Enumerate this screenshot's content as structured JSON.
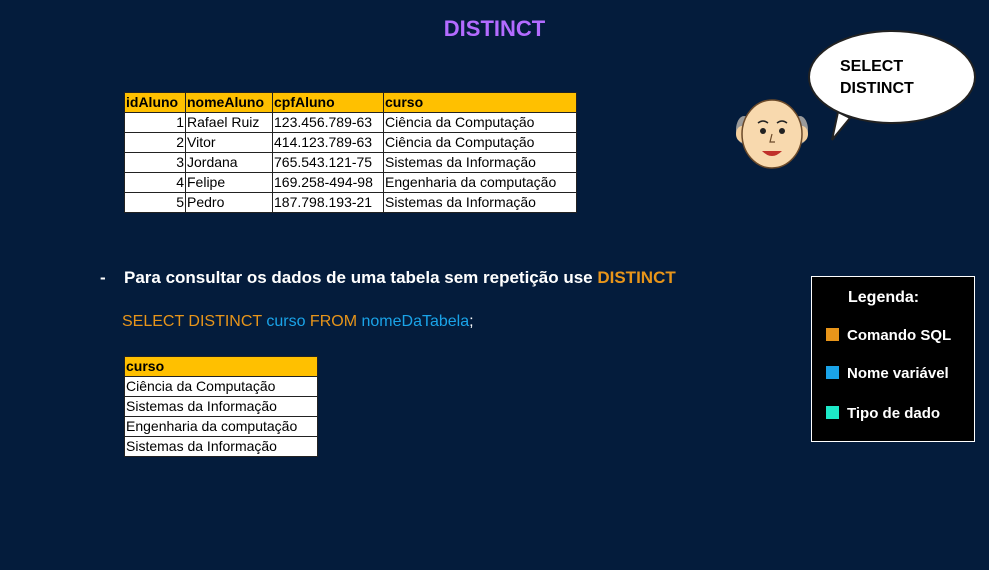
{
  "title": "DISTINCT",
  "table1": {
    "headers": [
      "idAluno",
      "nomeAluno",
      "cpfAluno",
      "curso"
    ],
    "rows": [
      [
        "1",
        "Rafael Ruiz",
        "123.456.789-63",
        "Ciência da Computação"
      ],
      [
        "2",
        "Vitor",
        "414.123.789-63",
        "Ciência da Computação"
      ],
      [
        "3",
        "Jordana",
        "765.543.121-75",
        "Sistemas da Informação"
      ],
      [
        "4",
        "Felipe",
        "169.258-494-98",
        "Engenharia da computação"
      ],
      [
        "5",
        "Pedro",
        "187.798.193-21",
        "Sistemas da Informação"
      ]
    ]
  },
  "bullet": {
    "dash": "-",
    "text": "Para consultar os dados de uma tabela sem repetição use ",
    "keyword": "DISTINCT"
  },
  "sql": {
    "cmd1": "SELECT DISTINCT",
    "var1": "curso",
    "cmd2": "FROM",
    "var2": "nomeDaTabela",
    "end": ";"
  },
  "table2": {
    "header": "curso",
    "rows": [
      "Ciência da Computação",
      "Sistemas da Informação",
      "Engenharia da computação",
      "Sistemas da Informação"
    ]
  },
  "bubble": {
    "line1": "SELECT",
    "line2": "DISTINCT"
  },
  "legend": {
    "title": "Legenda:",
    "items": [
      {
        "label": "Comando SQL",
        "color": "#e8951a"
      },
      {
        "label": "Nome variável",
        "color": "#1aa3e8"
      },
      {
        "label": "Tipo de dado",
        "color": "#1de9c8"
      }
    ]
  }
}
